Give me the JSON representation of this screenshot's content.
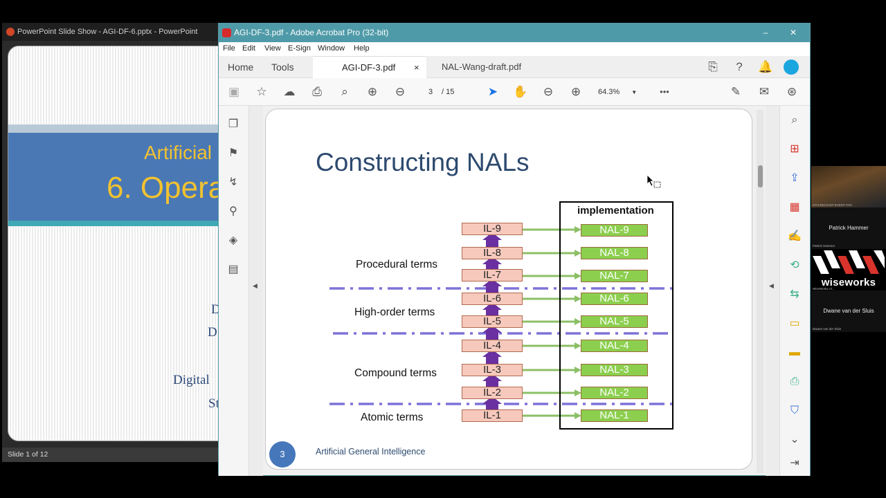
{
  "powerpoint": {
    "title": "PowerPoint Slide Show  -  AGI-DF-6.pptx - PowerPoint",
    "slide_line1": "Artificial",
    "slide_line2": "6. Opera",
    "slide_sub1": "D",
    "slide_sub2": "D",
    "slide_sub3": "Digital",
    "slide_sub4": "St",
    "status": "Slide 1 of 12"
  },
  "acrobat": {
    "title": "AGI-DF-3.pdf - Adobe Acrobat Pro (32-bit)",
    "window_buttons": {
      "minimize": "–",
      "maximize": "▢",
      "close": "✕"
    },
    "menu": [
      "File",
      "Edit",
      "View",
      "E-Sign",
      "Window",
      "Help"
    ],
    "tabs": {
      "home": "Home",
      "tools": "Tools",
      "doc1": "AGI-DF-3.pdf",
      "doc1_close": "×",
      "doc2": "NAL-Wang-draft.pdf"
    },
    "toolbar": {
      "page_current": "3",
      "page_total": "/  15",
      "zoom": "64.3%",
      "more": "•••"
    }
  },
  "slide": {
    "title": "Constructing NALs",
    "impl_title": "implementation",
    "il_levels": [
      "IL-9",
      "IL-8",
      "IL-7",
      "IL-6",
      "IL-5",
      "IL-4",
      "IL-3",
      "IL-2",
      "IL-1"
    ],
    "nal_levels": [
      "NAL-9",
      "NAL-8",
      "NAL-7",
      "NAL-6",
      "NAL-5",
      "NAL-4",
      "NAL-3",
      "NAL-2",
      "NAL-1"
    ],
    "terms": {
      "procedural": "Procedural terms",
      "high_order": "High-order terms",
      "compound": "Compound terms",
      "atomic": "Atomic terms"
    },
    "page_number": "3",
    "footer": "Artificial General Intelligence"
  },
  "video": {
    "tile1_caption": "KTH-EECS-DF-EVENT-TAN",
    "tile1_name": "Patrick Hammer",
    "tile1_small": "Patrick Hammer",
    "tile2_logo": "wiseworks",
    "tile2_caption": "WiseWorks.Al...",
    "tile2_name": "Dwane van der Sluis",
    "tile2_small": "Dwane van der Sluis"
  },
  "colors": {
    "acrobat_titlebar": "#4f9aa8",
    "ppt_band": "#4a78b4",
    "slide_title": "#2d4a6e",
    "il_fill": "#f7c9bd",
    "nal_fill": "#8ccf4f",
    "divider": "#7d72d8",
    "arrow": "#6a2fa0"
  }
}
